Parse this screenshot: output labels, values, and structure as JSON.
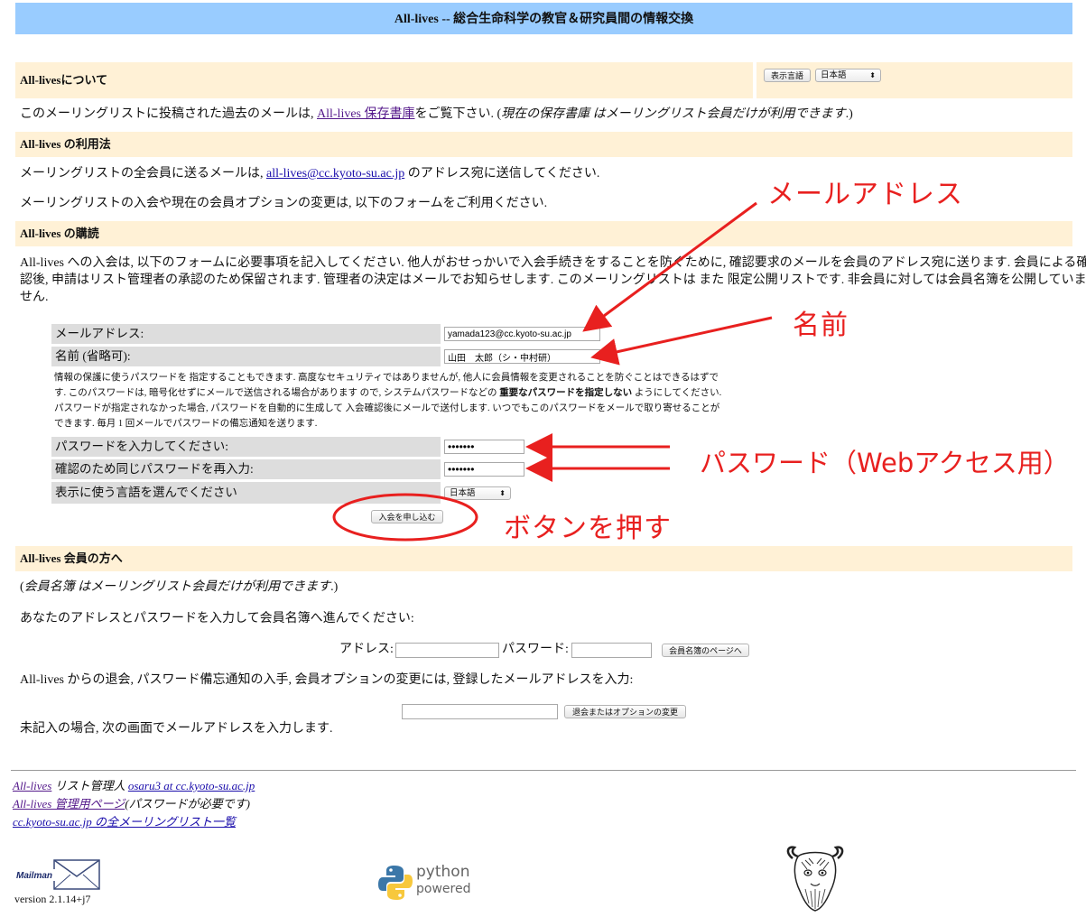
{
  "header": {
    "title": "All-lives -- 総合生命科学の教官＆研究員間の情報交換"
  },
  "language_bar": {
    "button": "表示言語",
    "selected": "日本語"
  },
  "about": {
    "heading": "All-livesについて",
    "text_before": "このメーリングリストに投稿された過去のメールは,",
    "archive_link": "All-lives 保存書庫",
    "text_mid": "をご覧下さい. (",
    "text_italic": "現在の保存書庫 はメーリングリスト会員だけが利用できます",
    "text_end": ".)"
  },
  "usage": {
    "heading": "All-lives の利用法",
    "line1_before": "メーリングリストの全会員に送るメールは,",
    "list_address": "all-lives@cc.kyoto-su.ac.jp",
    "line1_after": "のアドレス宛に送信してください.",
    "line2": "メーリングリストの入会や現在の会員オプションの変更は, 以下のフォームをご利用ください."
  },
  "subscribe": {
    "heading": "All-lives の購読",
    "intro_lines": [
      "All-lives への入会は, 以下のフォームに必要事項を記入してください. 他人がおせっかいで入会手続きをすることを防ぐために, 確認要求のメールを会員のアドレス宛に送ります. 会員による確",
      "認後, 申請はリスト管理者の承認のため保留されます. 管理者の決定はメールでお知らせします. このメーリングリストは また 限定公開リストです. 非会員に対しては会員名簿を公開していま",
      "せん."
    ],
    "email_label": "メールアドレス:",
    "email_value": "yamada123@cc.kyoto-su.ac.jp",
    "name_label": "名前 (省略可):",
    "name_value": "山田　太郎（シ・中村研）",
    "password_note": {
      "line1": "情報の保護に使うパスワードを 指定することもできます. 高度なセキュリティではありませんが, 他人に会員情報を変更されることを防ぐことはできるはずで",
      "line2_before": "す. このパスワードは, 暗号化せずにメールで送信される場合があります ので, システムパスワードなどの",
      "line2_bold": "重要なパスワードを指定しない",
      "line2_after": "ようにしてください.",
      "line3": "パスワードが指定されなかった場合, パスワードを自動的に生成して 入会確認後にメールで送付します. いつでもこのパスワードをメールで取り寄せることが",
      "line4": "できます. 毎月 1 回メールでパスワードの備忘通知を送ります."
    },
    "password_label": "パスワードを入力してください:",
    "password_value": "•••••••",
    "confirm_label": "確認のため同じパスワードを再入力:",
    "confirm_value": "•••••••",
    "language_label": "表示に使う言語を選んでください",
    "language_value": "日本語",
    "submit_label": "入会を申し込む"
  },
  "members": {
    "heading": "All-lives 会員の方へ",
    "note_open": "(",
    "note_italic": "会員名簿 はメーリングリスト会員だけが利用できます",
    "note_close": ".)",
    "roster_prompt": "あなたのアドレスとパスワードを入力して会員名簿へ進んでください:",
    "address_label": "アドレス:",
    "password_label": "パスワード:",
    "roster_button": "会員名簿のページへ",
    "unsub_prompt": "All-lives からの退会, パスワード備忘通知の入手, 会員オプションの変更には, 登録したメールアドレスを入力:",
    "unsub_button": "退会またはオプションの変更",
    "unsub_note": "未記入の場合, 次の画面でメールアドレスを入力します."
  },
  "footer": {
    "list_link": "All-lives",
    "admin_text": "リスト管理人",
    "admin_email": "osaru3 at cc.kyoto-su.ac.jp",
    "admin_page_link": "All-lives 管理用ページ",
    "admin_page_note": "(パスワードが必要です)",
    "all_lists_link": "cc.kyoto-su.ac.jp の全メーリングリスト一覧",
    "mailman_logo_text": "Mailman",
    "version": "version 2.1.14+j7",
    "python_word1": "python",
    "python_word2": "powered"
  },
  "annotations": {
    "email": "メールアドレス",
    "name": "名前",
    "password": "パスワード（Webアクセス用）",
    "button": "ボタンを押す",
    "color": "#e8201f"
  }
}
